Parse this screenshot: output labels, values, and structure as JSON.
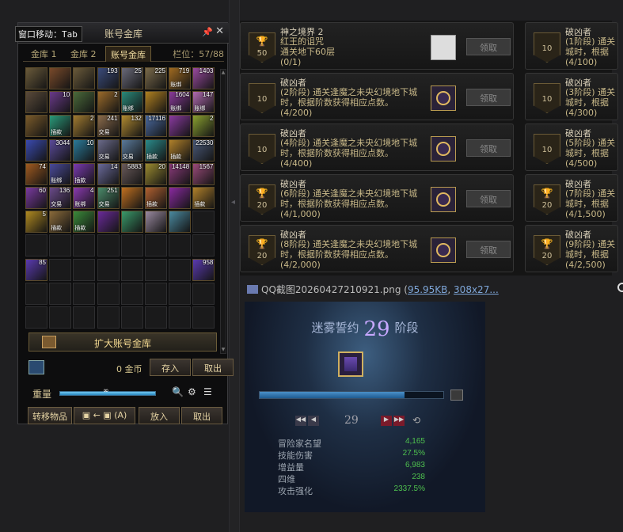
{
  "warehouse": {
    "title": "账号金库",
    "move_hint": "窗口移动：Tab",
    "tabs": [
      "金库 1",
      "金库 2",
      "账号金库"
    ],
    "slots": "栏位：57/88",
    "expand_label": "扩大账号金库",
    "gold_amount": "0 金币",
    "deposit_label": "存入",
    "withdraw_label": "取出",
    "weight_label": "重量",
    "weight_value": "∞",
    "weight_fill": 1.0,
    "transfer_label": "转移物品",
    "arrow_label": "←",
    "hotkey_label": "(A)",
    "put_in_label": "放入",
    "take_out_label": "取出",
    "items": [
      {
        "c": "#6a5a3a"
      },
      {
        "c": "#7a4a2a"
      },
      {
        "c": "#6a5a3a"
      },
      {
        "c": "#3a4a7a",
        "n": "193"
      },
      {
        "c": "#6a6a7a",
        "n": "25"
      },
      {
        "c": "#7a6a4a",
        "n": "225"
      },
      {
        "c": "#a06a20",
        "n": "719",
        "t": "账绑"
      },
      {
        "c": "#9a4aa0",
        "n": "1403"
      },
      {
        "c": "#5a4a3a"
      },
      {
        "c": "#6a3a8a",
        "n": "10"
      },
      {
        "c": "#4a6a3a"
      },
      {
        "c": "#9a6a2a",
        "n": "2"
      },
      {
        "c": "#2a8a7a",
        "t": "账绑"
      },
      {
        "c": "#b08020"
      },
      {
        "c": "#8a3a9a",
        "n": "1604",
        "t": "账绑"
      },
      {
        "c": "#b06ab0",
        "n": "147",
        "t": "账绑"
      },
      {
        "c": "#7a5a2a"
      },
      {
        "c": "#2a9a7a",
        "t": "插款"
      },
      {
        "c": "#a07a30",
        "n": "2"
      },
      {
        "c": "#8a6a4a",
        "n": "241",
        "t": "交易"
      },
      {
        "c": "#b08a30",
        "n": "132"
      },
      {
        "c": "#4a6aa0",
        "n": "17116"
      },
      {
        "c": "#8a3aa0"
      },
      {
        "c": "#8aa030",
        "n": "2"
      },
      {
        "c": "#3a4ab0"
      },
      {
        "c": "#5a4a9a",
        "n": "3044"
      },
      {
        "c": "#2a7a9a",
        "n": "10"
      },
      {
        "c": "#6a6a8a",
        "t": "交易"
      },
      {
        "c": "#5a7a9a",
        "t": "交易"
      },
      {
        "c": "#2a8a8a",
        "t": "插款"
      },
      {
        "c": "#b0802a",
        "t": "插款"
      },
      {
        "c": "#4a5a7a",
        "n": "22530"
      },
      {
        "c": "#a05a20",
        "n": "74"
      },
      {
        "c": "#4a4a9a",
        "t": "账绑"
      },
      {
        "c": "#7a3ab0",
        "t": "插款"
      },
      {
        "c": "#6a6a9a",
        "n": "14"
      },
      {
        "c": "#6a5a5a",
        "n": "5883"
      },
      {
        "c": "#9a8a30",
        "n": "20"
      },
      {
        "c": "#8a3a7a",
        "n": "14148"
      },
      {
        "c": "#9a4a7a",
        "n": "1567"
      },
      {
        "c": "#7a3aa0",
        "n": "60"
      },
      {
        "c": "#6a4a8a",
        "n": "136",
        "t": "交易"
      },
      {
        "c": "#8a3ab0",
        "n": "4",
        "t": "账绑"
      },
      {
        "c": "#4a8a6a",
        "n": "251",
        "t": "交易"
      },
      {
        "c": "#c07020"
      },
      {
        "c": "#b06030",
        "t": "插款"
      },
      {
        "c": "#8a2aa0"
      },
      {
        "c": "#b0802a",
        "t": "插款"
      },
      {
        "c": "#b08a20",
        "n": "5"
      },
      {
        "c": "#8a6a3a",
        "t": "插款"
      },
      {
        "c": "#3a8a3a",
        "t": "插款"
      },
      {
        "c": "#6a2a9a"
      },
      {
        "c": "#3a9a6a"
      },
      {
        "c": "#9a8aa0"
      },
      {
        "c": "#4a8aa0"
      },
      {
        "c": "#5a3aa0",
        "n": "17"
      },
      {
        "c": "#5a3ab0",
        "n": "85"
      },
      {
        "c": "#5a3ab0",
        "n": "958"
      }
    ]
  },
  "achievements": {
    "claim_label": "领取",
    "cards": [
      {
        "title": "神之境界 2",
        "desc": "红王的诅咒\n通关地下60层",
        "progress": "(0/1)",
        "badge": "50",
        "trophy": true,
        "reward": "scroll"
      },
      {
        "title": "破凶者",
        "desc": "(2阶段) 通关逢魔之未央幻境地下城时，根据阶数获得相应点数。",
        "progress": "(4/200)",
        "badge": "10",
        "trophy": false,
        "reward": "emblem"
      },
      {
        "title": "破凶者",
        "desc": "(4阶段) 通关逢魔之未央幻境地下城时，根据阶数获得相应点数。",
        "progress": "(4/400)",
        "badge": "10",
        "trophy": false,
        "reward": "emblem"
      },
      {
        "title": "破凶者",
        "desc": "(6阶段) 通关逢魔之未央幻境地下城时，根据阶数获得相应点数。",
        "progress": "(4/1,000)",
        "badge": "20",
        "trophy": true,
        "reward": "emblem"
      },
      {
        "title": "破凶者",
        "desc": "(8阶段) 通关逢魔之未央幻境地下城时，根据阶数获得相应点数。",
        "progress": "(4/2,000)",
        "badge": "20",
        "trophy": true,
        "reward": "emblem"
      }
    ],
    "right_cards": [
      {
        "title": "破凶者",
        "desc": "(1阶段) 通关\n城时，根据",
        "progress": "(4/100)",
        "badge": "10",
        "trophy": false
      },
      {
        "title": "破凶者",
        "desc": "(3阶段) 通关\n城时，根据",
        "progress": "(4/300)",
        "badge": "10",
        "trophy": false
      },
      {
        "title": "破凶者",
        "desc": "(5阶段) 通关\n城时，根据",
        "progress": "(4/500)",
        "badge": "10",
        "trophy": false
      },
      {
        "title": "破凶者",
        "desc": "(7阶段) 通关\n城时，根据",
        "progress": "(4/1,500)",
        "badge": "20",
        "trophy": true
      },
      {
        "title": "破凶者",
        "desc": "(9阶段) 通关\n城时，根据",
        "progress": "(4/2,500)",
        "badge": "20",
        "trophy": true
      }
    ]
  },
  "file": {
    "name": "QQ截图20260427210921.png (",
    "size": "95.95KB",
    "sep": ", ",
    "dims": "308x27..."
  },
  "pact": {
    "title_prefix": "迷雾誓约",
    "stage": "29",
    "title_suffix": "阶段",
    "progress_fraction": 0.79,
    "stepper_value": "29",
    "stats": [
      {
        "label": "冒险家名望",
        "value": "4,165"
      },
      {
        "label": "技能伤害",
        "value": "27.5%"
      },
      {
        "label": "增益量",
        "value": "6,983"
      },
      {
        "label": "四维",
        "value": "238"
      },
      {
        "label": "攻击强化",
        "value": "2337.5%"
      }
    ]
  }
}
